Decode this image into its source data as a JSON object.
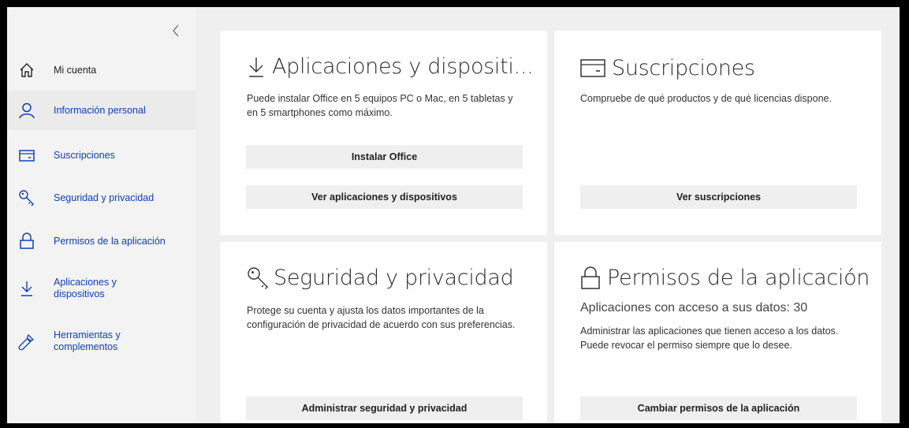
{
  "sidebar": {
    "collapse_icon": "chevron-left-icon",
    "items": [
      {
        "label": "Mi cuenta",
        "icon": "home-icon"
      },
      {
        "label": "Información personal",
        "icon": "person-icon"
      },
      {
        "label": "Suscripciones",
        "icon": "card-icon"
      },
      {
        "label": "Seguridad y privacidad",
        "icon": "key-icon"
      },
      {
        "label": "Permisos de la aplicación",
        "icon": "lock-icon"
      },
      {
        "label": "Aplicaciones y dispositivos",
        "icon": "download-icon"
      },
      {
        "label": "Herramientas y complementos",
        "icon": "wrench-icon"
      }
    ]
  },
  "cards": {
    "apps": {
      "title": "Aplicaciones y dispositi...",
      "icon": "download-icon",
      "description": "Puede instalar Office en 5 equipos PC o Mac, en 5 tabletas y en 5 smartphones como máximo.",
      "install_button": "Instalar Office",
      "view_button": "Ver aplicaciones y dispositivos"
    },
    "subscriptions": {
      "title": "Suscripciones",
      "icon": "card-icon",
      "description": "Compruebe de qué productos y de qué licencias dispone.",
      "view_button": "Ver suscripciones"
    },
    "security": {
      "title": "Seguridad y privacidad",
      "icon": "key-icon",
      "description": "Protege su cuenta y ajusta los datos importantes de la configuración de privacidad de acuerdo con sus preferencias.",
      "manage_button": "Administrar seguridad y privacidad"
    },
    "permissions": {
      "title": "Permisos de la aplicación",
      "icon": "lock-icon",
      "subtitle": "Aplicaciones con acceso a sus datos: 30",
      "description": "Administrar las aplicaciones que tienen acceso a los datos. Puede revocar el permiso siempre que lo desee.",
      "change_button": "Cambiar permisos de la aplicación"
    }
  },
  "colors": {
    "link": "#0f3fbf",
    "card_bg": "#ffffff",
    "page_bg": "#efefef",
    "button_bg": "#efefef"
  }
}
